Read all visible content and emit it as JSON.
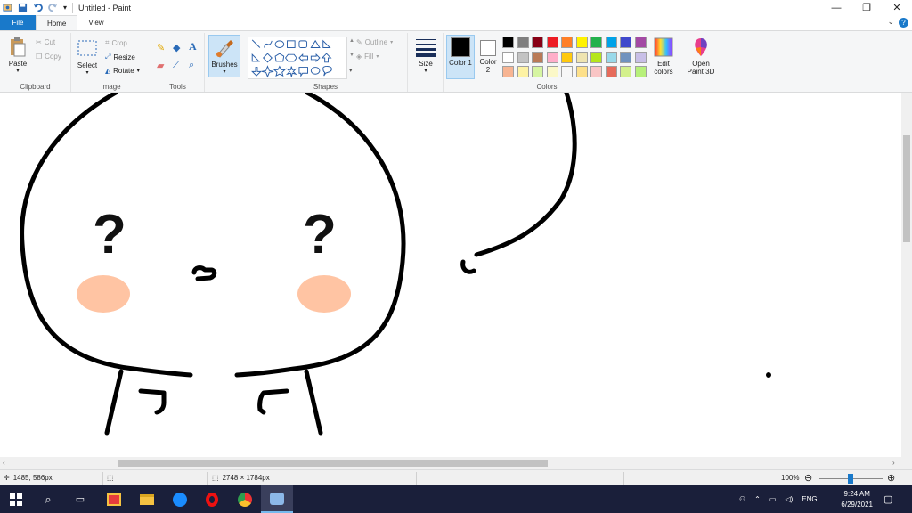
{
  "window": {
    "title": "Untitled - Paint",
    "minimize_glyph": "—",
    "restore_glyph": "❐",
    "close_glyph": "✕"
  },
  "tabs": [
    "File",
    "Home",
    "View"
  ],
  "ribbon": {
    "clipboard": {
      "label": "Clipboard",
      "paste": "Paste",
      "cut": "Cut",
      "copy": "Copy"
    },
    "image": {
      "label": "Image",
      "select": "Select",
      "crop": "Crop",
      "resize": "Resize",
      "rotate": "Rotate"
    },
    "tools": {
      "label": "Tools"
    },
    "brushes": {
      "label": "Brushes"
    },
    "shapes": {
      "label": "Shapes",
      "outline": "Outline",
      "fill": "Fill"
    },
    "size": {
      "label": "Size"
    },
    "colors": {
      "label": "Colors",
      "color1_label": "Color 1",
      "color2_label": "Color 2",
      "edit": "Edit colors",
      "open3d": "Open Paint 3D",
      "color1": "#000000",
      "color2": "#ffffff",
      "row1": [
        "#000000",
        "#7f7f7f",
        "#880015",
        "#ed1c24",
        "#ff7f27",
        "#fff200",
        "#22b14c",
        "#00a2e8",
        "#3f48cc",
        "#a349a4"
      ],
      "row2": [
        "#ffffff",
        "#c3c3c3",
        "#b97a57",
        "#ffaec9",
        "#ffc90e",
        "#efe4b0",
        "#b5e61d",
        "#99d9ea",
        "#7092be",
        "#c8bfe7"
      ],
      "row3": [
        "#f7b492",
        "#fdf2a4",
        "#d6f5a2",
        "#fbf8c8",
        "#f7f7f7",
        "#fde08a",
        "#f9c5c5",
        "#e66b5b",
        "#d3f08c",
        "#b7f07a"
      ]
    }
  },
  "statusbar": {
    "cursor": "1485, 586px",
    "size": "2748 × 1784px",
    "zoom": "100%"
  },
  "taskbar": {
    "lang": "ENG",
    "time": "9:24 AM",
    "date": "6/29/2021"
  },
  "canvas": {
    "left_eye": "?",
    "right_eye": "?",
    "cheek_color": "#ffc4a3"
  }
}
